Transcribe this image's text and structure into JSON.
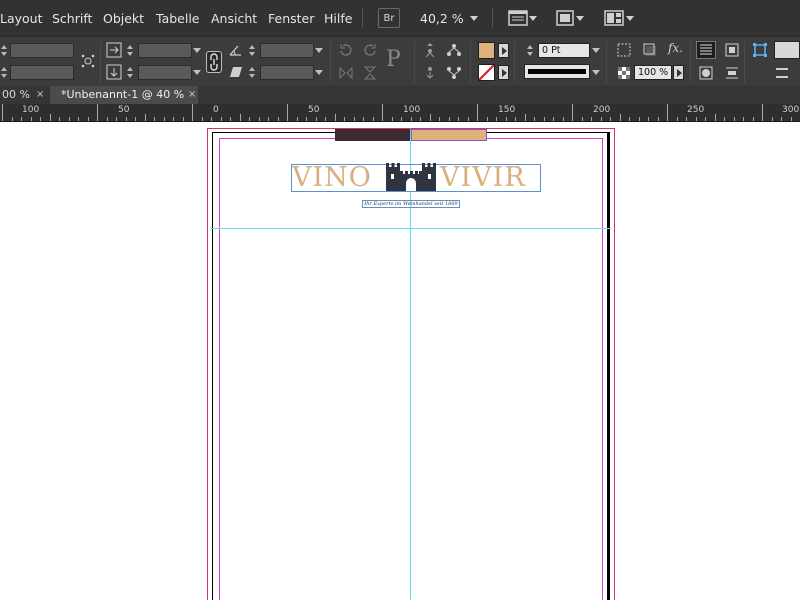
{
  "menubar": {
    "items": [
      "Layout",
      "Schrift",
      "Objekt",
      "Tabelle",
      "Ansicht",
      "Fenster",
      "Hilfe"
    ],
    "bridge_label": "Br",
    "zoom": "40,2 %"
  },
  "control_panel": {
    "stroke_weight": "0 Pt",
    "opacity": "100 %",
    "fill_color": "#dfb27d",
    "stroke_color": "#000000",
    "icons": [
      "x-position-icon",
      "constrain-proportions-icon",
      "rotate-icon",
      "shear-icon",
      "rotate-90-cw-icon",
      "rotate-90-ccw-icon",
      "select-container-icon",
      "flip-horizontal-icon",
      "flip-vertical-icon",
      "effects-icon"
    ]
  },
  "tabs": [
    {
      "label": "00 %",
      "close": "×"
    },
    {
      "label": "*Unbenannt-1 @ 40 %",
      "close": "×",
      "active": true
    }
  ],
  "ruler": {
    "labels": [
      "100",
      "50",
      "0",
      "50",
      "100",
      "150",
      "200",
      "250",
      "300"
    ]
  },
  "document": {
    "logo_left": "VINO",
    "logo_right": "VIVIR",
    "logo_color": "#d8b07e",
    "castle_color": "#2e3440",
    "tagline": "Ihr Experte im Weinhandel seit 1869",
    "swatch_colors": [
      "#3b2a33",
      "#dfb27d"
    ]
  }
}
